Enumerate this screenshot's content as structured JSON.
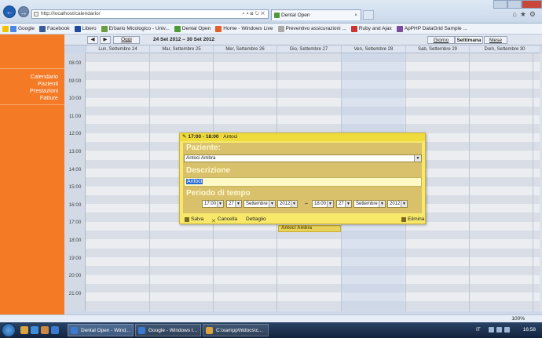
{
  "browser": {
    "address": "http://localhost/calendario/",
    "tab_title": "Dental Open",
    "favorites": [
      "Google",
      "Facebook",
      "Libero",
      "Erbario Micologico - Univ...",
      "Dental Open",
      "Home - Windows Live",
      "Preventivo assicurazioni ...",
      "Ruby and Ajax",
      "ApPHP DataGrid Sample ..."
    ],
    "zoom": "100%"
  },
  "sidebar": {
    "items": [
      "Calendario",
      "Pazienti",
      "Prestazioni",
      "Fatture"
    ]
  },
  "calendar": {
    "prev": "◀",
    "next": "▶",
    "today": "Oggi",
    "range": "24 Set 2012 – 30 Set 2012",
    "views": [
      "Giorno",
      "Settimana",
      "Mese"
    ],
    "active_view": "Settimana",
    "days": [
      "Lun, Settembre 24",
      "Mar, Settembre 25",
      "Mer, Settembre 26",
      "Gio, Settembre 27",
      "Ven, Settembre 28",
      "Sab, Settembre 29",
      "Dom, Settembre 30"
    ],
    "hours": [
      "08:00",
      "09:00",
      "10:00",
      "11:00",
      "12:00",
      "13:00",
      "14:00",
      "15:00",
      "16:00",
      "17:00",
      "18:00",
      "19:00",
      "20:00",
      "21:00"
    ],
    "event_label": "Antoci Ambra"
  },
  "popup": {
    "time": "17:00 - 18:00",
    "title": "Antoci",
    "paziente_label": "Paziente:",
    "paziente_value": "Antoci Ambra",
    "descrizione_label": "Descrizione",
    "descrizione_value": "Antoci",
    "periodo_label": "Periodo di tempo",
    "start": {
      "time": "17:00",
      "day": "27",
      "month": "Settembre",
      "year": "2012"
    },
    "end": {
      "time": "18:00",
      "day": "27",
      "month": "Settembre",
      "year": "2012"
    },
    "dash": "–",
    "save": "Salva",
    "cancel": "Cancella",
    "detail": "Dettaglio",
    "delete": "Elimina"
  },
  "taskbar": {
    "tasks": [
      "Dental Open - Wind...",
      "Google - Windows I...",
      "C:\\xampp\\htdocs\\c..."
    ],
    "lang": "IT",
    "clock": "16:58"
  }
}
